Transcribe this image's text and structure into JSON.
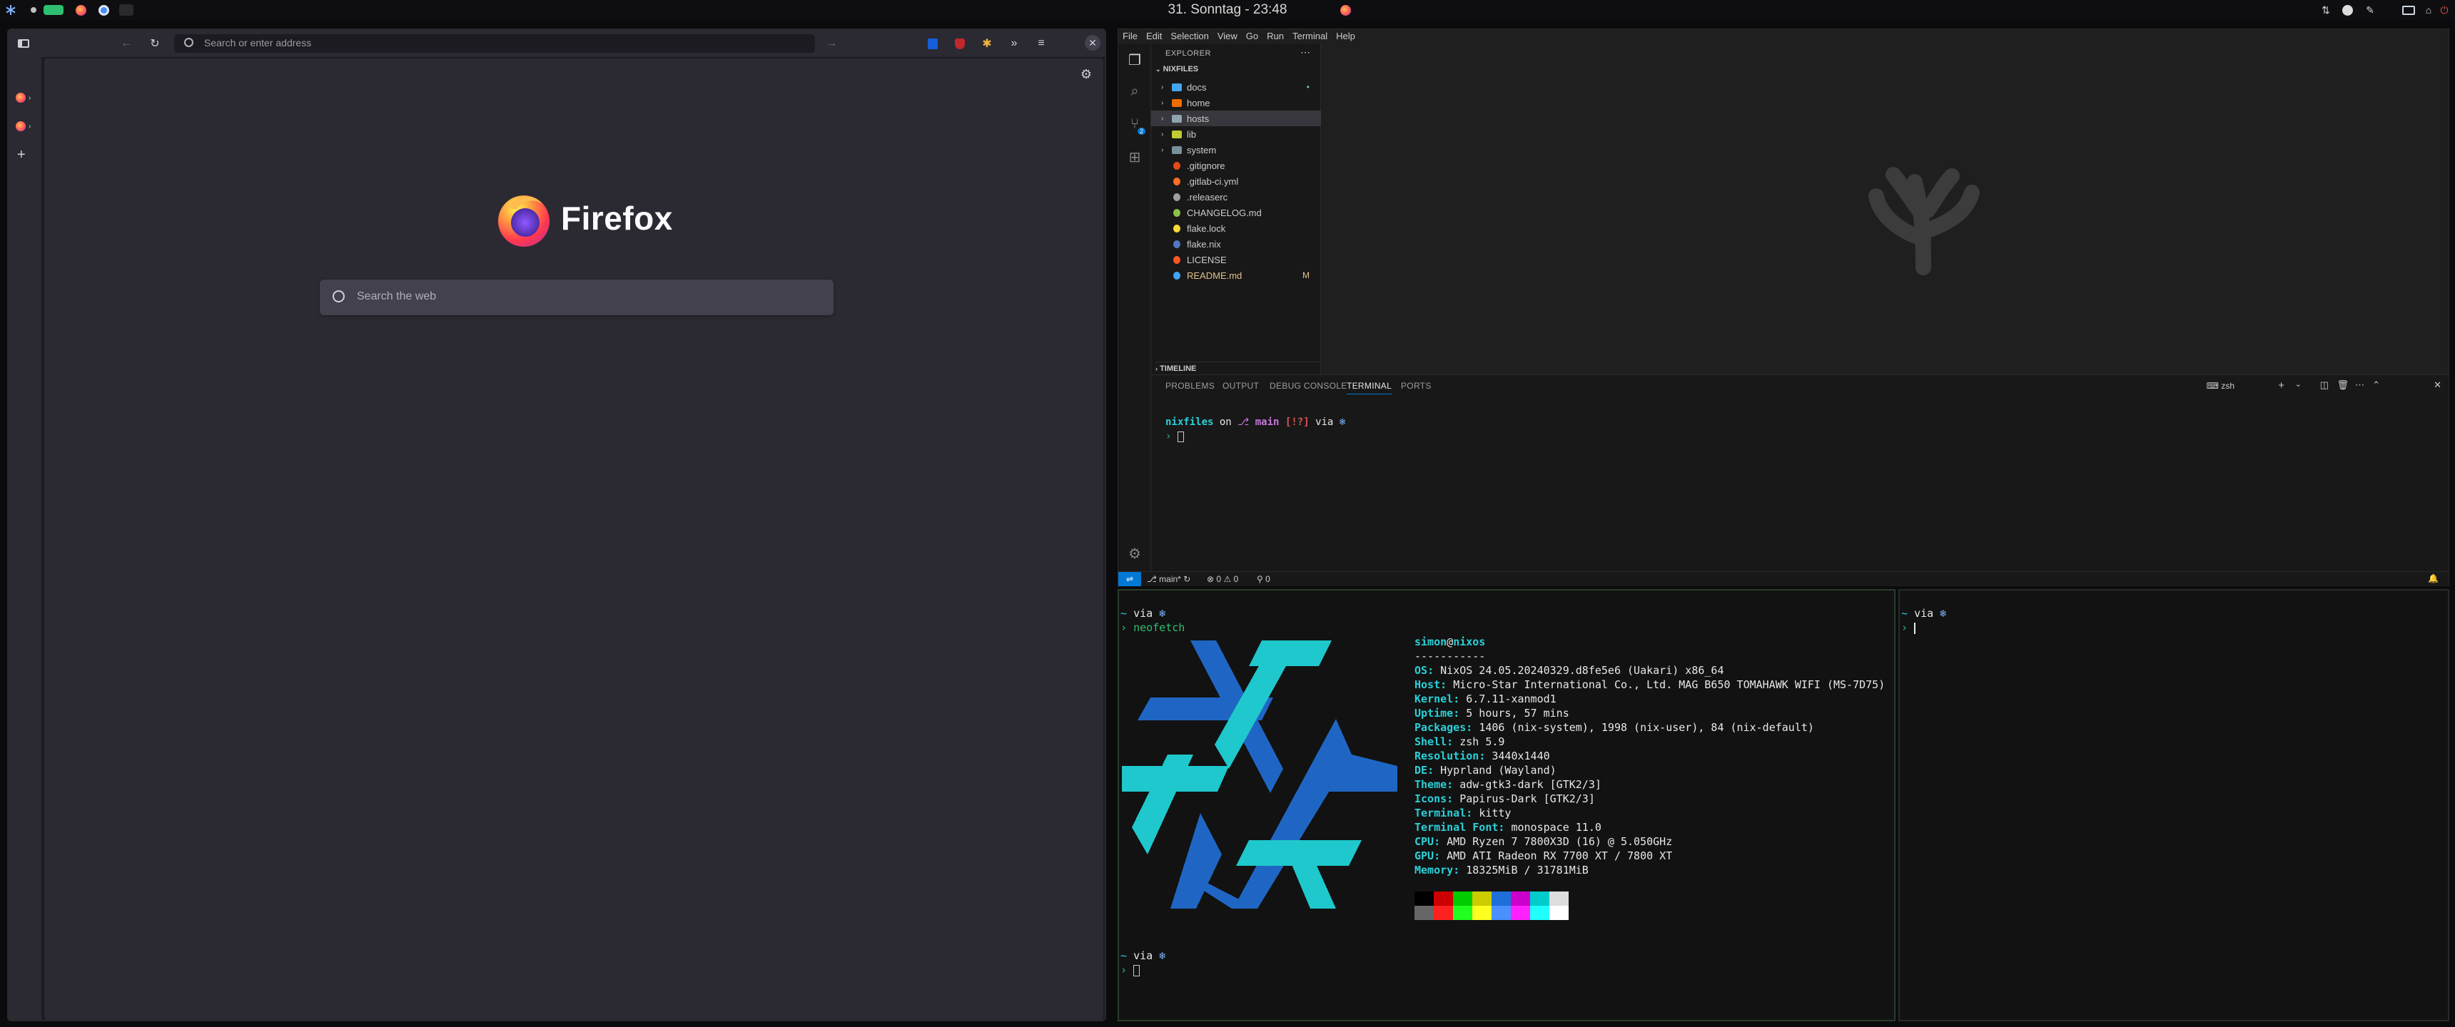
{
  "topbar": {
    "clock": "31. Sonntag - 23:48",
    "left_icons": [
      "nixos-snowflake-icon",
      "workspace-dot-icon",
      "workspace-active-icon",
      "firefox-icon",
      "chromium-icon",
      "workspace-empty-icon"
    ],
    "right_icons": [
      "network-icon",
      "steam-icon",
      "pen-icon",
      "display-icon",
      "power-icon"
    ]
  },
  "firefox": {
    "urlbar_placeholder": "Search or enter address",
    "logo_text": "Firefox",
    "search_placeholder": "Search the web"
  },
  "vscode": {
    "menu": [
      "File",
      "Edit",
      "Selection",
      "View",
      "Go",
      "Run",
      "Terminal",
      "Help"
    ],
    "explorer_title": "EXPLORER",
    "workspace": "NIXFILES",
    "tree": [
      {
        "name": "docs",
        "type": "folder",
        "color": "#42a5f5",
        "git": "•"
      },
      {
        "name": "home",
        "type": "folder",
        "color": "#ef6c00",
        "git": ""
      },
      {
        "name": "hosts",
        "type": "folder",
        "color": "#90a4ae",
        "git": ""
      },
      {
        "name": "lib",
        "type": "folder",
        "color": "#c0ca33",
        "git": ""
      },
      {
        "name": "system",
        "type": "folder",
        "color": "#78909c",
        "git": ""
      },
      {
        "name": ".gitignore",
        "type": "file",
        "color": "#e64a19",
        "git": ""
      },
      {
        "name": ".gitlab-ci.yml",
        "type": "file",
        "color": "#fc6d26",
        "git": ""
      },
      {
        "name": ".releaserc",
        "type": "file",
        "color": "#9e9e9e",
        "git": ""
      },
      {
        "name": "CHANGELOG.md",
        "type": "file",
        "color": "#8bc34a",
        "git": ""
      },
      {
        "name": "flake.lock",
        "type": "file",
        "color": "#fdd835",
        "git": ""
      },
      {
        "name": "flake.nix",
        "type": "file",
        "color": "#5277c3",
        "git": ""
      },
      {
        "name": "LICENSE",
        "type": "file",
        "color": "#ff5722",
        "git": ""
      },
      {
        "name": "README.md",
        "type": "file",
        "color": "#42a5f5",
        "git": "M"
      }
    ],
    "timeline": "TIMELINE",
    "panel_tabs": [
      "PROBLEMS",
      "OUTPUT",
      "DEBUG CONSOLE",
      "TERMINAL",
      "PORTS"
    ],
    "terminal_shell": "zsh",
    "prompt_dir": "nixfiles",
    "prompt_on": "on",
    "prompt_branch": "main",
    "prompt_status": "[!?]",
    "prompt_via": "via",
    "status_branch": "main*",
    "status_errors": "0",
    "status_warnings": "0",
    "status_ports": "0",
    "scm_badge": "2"
  },
  "kitty_left": {
    "prompt_via": "via",
    "command": "neofetch",
    "user": "simon",
    "at": "@",
    "host": "nixos",
    "separator": "-----------",
    "info": [
      {
        "k": "OS",
        "v": "NixOS 24.05.20240329.d8fe5e6 (Uakari) x86_64"
      },
      {
        "k": "Host",
        "v": "Micro-Star International Co., Ltd. MAG B650 TOMAHAWK WIFI (MS-7D75)"
      },
      {
        "k": "Kernel",
        "v": "6.7.11-xanmod1"
      },
      {
        "k": "Uptime",
        "v": "5 hours, 57 mins"
      },
      {
        "k": "Packages",
        "v": "1406 (nix-system), 1998 (nix-user), 84 (nix-default)"
      },
      {
        "k": "Shell",
        "v": "zsh 5.9"
      },
      {
        "k": "Resolution",
        "v": "3440x1440"
      },
      {
        "k": "DE",
        "v": "Hyprland (Wayland)"
      },
      {
        "k": "Theme",
        "v": "adw-gtk3-dark [GTK2/3]"
      },
      {
        "k": "Icons",
        "v": "Papirus-Dark [GTK2/3]"
      },
      {
        "k": "Terminal",
        "v": "kitty"
      },
      {
        "k": "Terminal Font",
        "v": "monospace 11.0"
      },
      {
        "k": "CPU",
        "v": "AMD Ryzen 7 7800X3D (16) @ 5.050GHz"
      },
      {
        "k": "GPU",
        "v": "AMD ATI Radeon RX 7700 XT / 7800 XT"
      },
      {
        "k": "Memory",
        "v": "18325MiB / 31781MiB"
      }
    ],
    "palette_top": [
      "#000000",
      "#cc0000",
      "#00cc00",
      "#cccc00",
      "#1e6fd9",
      "#cc00cc",
      "#00cccc",
      "#dddddd"
    ],
    "palette_bottom": [
      "#666666",
      "#ff2020",
      "#20ff20",
      "#ffff20",
      "#4a90ff",
      "#ff20ff",
      "#20ffff",
      "#ffffff"
    ]
  },
  "kitty_right": {
    "prompt_via": "via"
  }
}
